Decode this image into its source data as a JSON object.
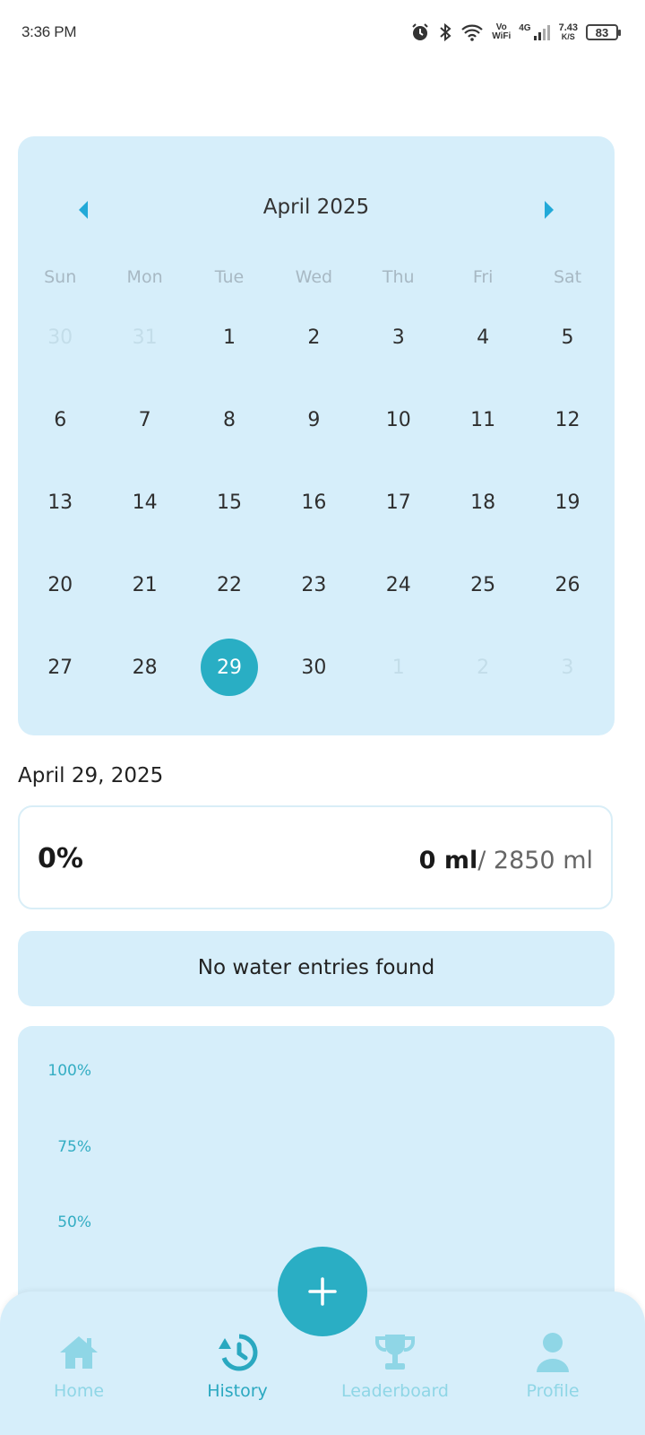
{
  "status_bar": {
    "time": "3:36 PM",
    "network_vo": "Vo",
    "network_wifi": "WiFi",
    "network_4g": "4G",
    "speed_value": "7.43",
    "speed_unit": "K/S",
    "battery": "83"
  },
  "calendar": {
    "title": "April 2025",
    "weekdays": [
      "Sun",
      "Mon",
      "Tue",
      "Wed",
      "Thu",
      "Fri",
      "Sat"
    ],
    "weeks": [
      [
        "30",
        "31",
        "1",
        "2",
        "3",
        "4",
        "5"
      ],
      [
        "6",
        "7",
        "8",
        "9",
        "10",
        "11",
        "12"
      ],
      [
        "13",
        "14",
        "15",
        "16",
        "17",
        "18",
        "19"
      ],
      [
        "20",
        "21",
        "22",
        "23",
        "24",
        "25",
        "26"
      ],
      [
        "27",
        "28",
        "29",
        "30",
        "1",
        "2",
        "3"
      ]
    ]
  },
  "selected_date_label": "April 29, 2025",
  "progress": {
    "percent": "0%",
    "consumed": "0 ml",
    "goal": "/ 2850 ml"
  },
  "entries": {
    "empty_message": "No water entries found"
  },
  "chart": {
    "y_ticks": [
      "100%",
      "75%",
      "50%"
    ]
  },
  "chart_data": {
    "type": "bar",
    "categories": [],
    "values": [],
    "title": "",
    "xlabel": "",
    "ylabel": "",
    "yticks": [
      "100%",
      "75%",
      "50%"
    ]
  },
  "bottom_nav": {
    "home": "Home",
    "history": "History",
    "leaderboard": "Leaderboard",
    "profile": "Profile"
  },
  "colors": {
    "accent": "#2aaec4",
    "card_bg": "#d6eefa",
    "nav_inactive": "#8fd6e6"
  }
}
